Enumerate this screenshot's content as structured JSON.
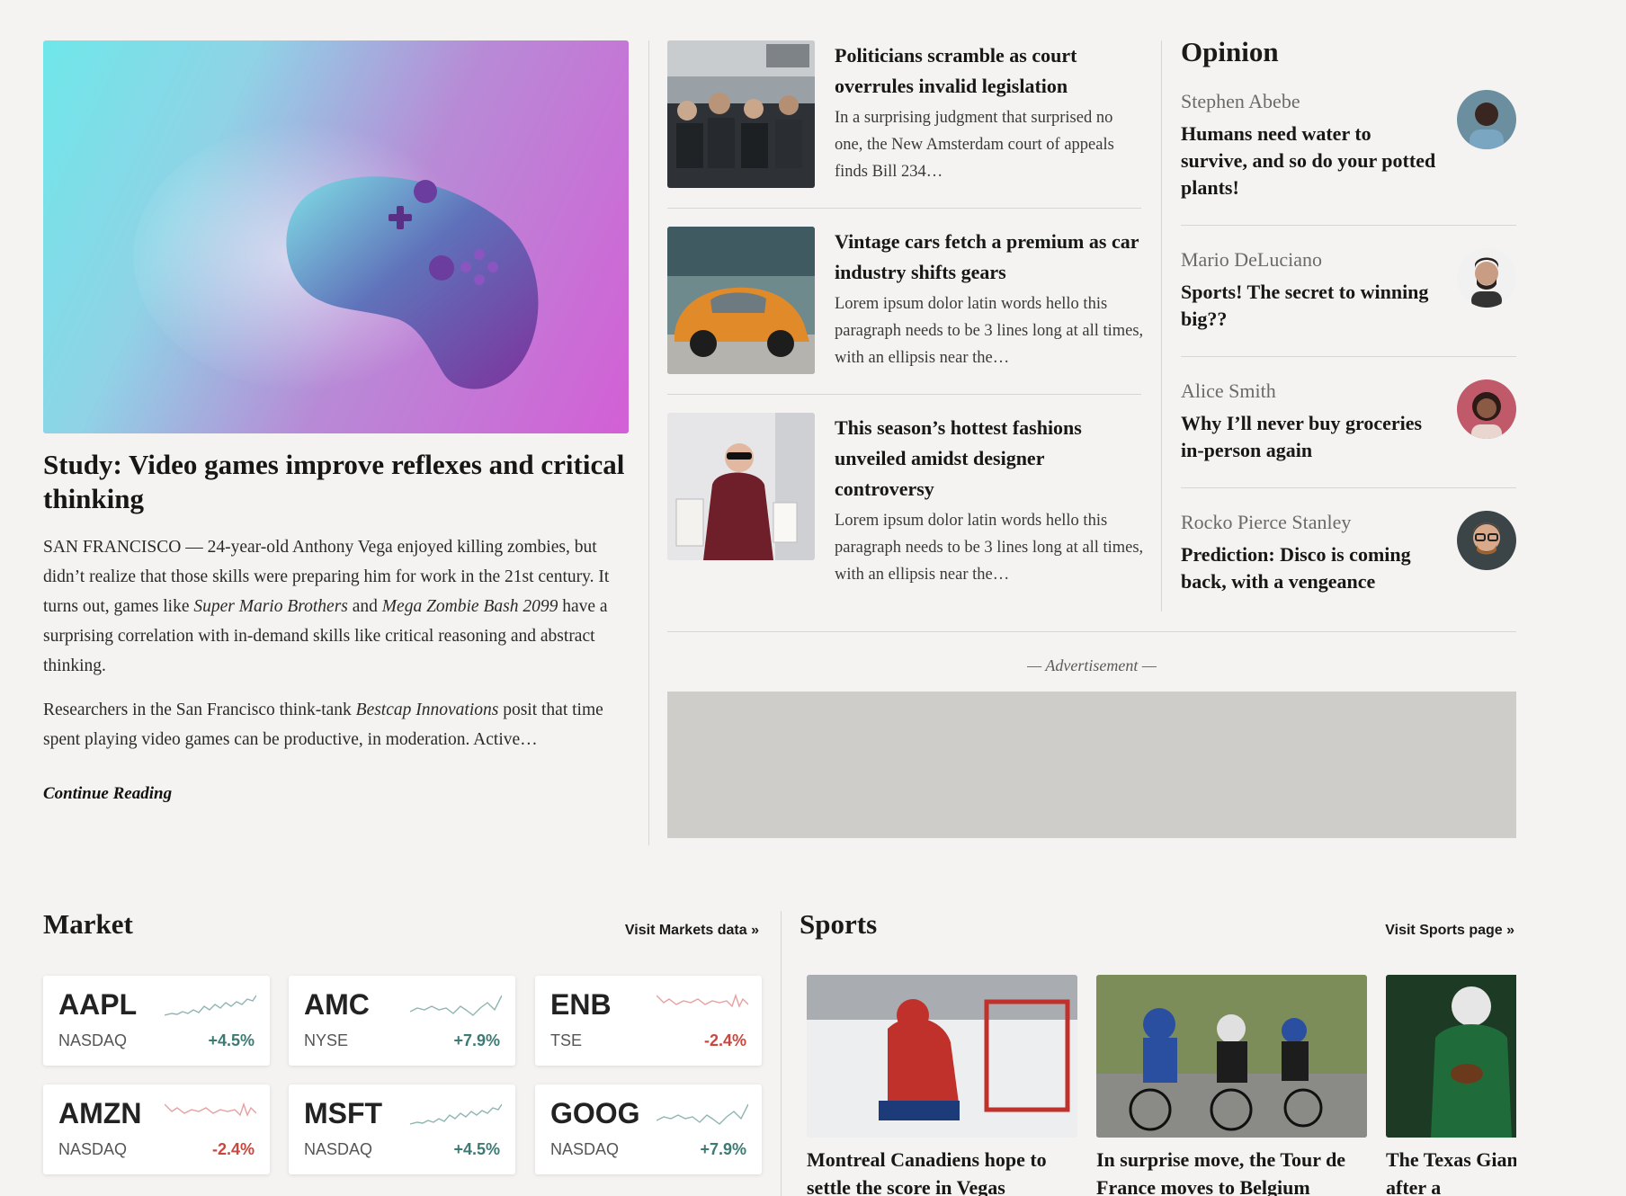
{
  "featured": {
    "title": "Study: Video games improve reflexes and critical thinking",
    "p1_a": "SAN FRANCISCO — 24-year-old Anthony Vega enjoyed killing zombies, but didn’t realize that those skills were preparing him for work in the 21st century. It turns out, games like ",
    "p1_em1": "Super Mario Brothers",
    "p1_b": " and ",
    "p1_em2": "Mega Zombie Bash 2099",
    "p1_c": " have a surprising correlation with in-demand skills like critical reasoning and abstract thinking.",
    "p2_a": "Researchers in the San Francisco think-tank ",
    "p2_em": "Bestcap Innovations",
    "p2_b": " posit that time spent playing video games can be productive, in moderation. Active…",
    "continue": "Continue Reading"
  },
  "stories": [
    {
      "title": "Politicians scramble as court overrules invalid legislation",
      "summary": "In a surprising judgment that surprised no one, the New Amsterdam court of appeals finds Bill 234…"
    },
    {
      "title": "Vintage cars fetch a premium as car industry shifts gears",
      "summary": "Lorem ipsum dolor latin words hello this paragraph needs to be 3 lines long at all times, with an ellipsis near the…"
    },
    {
      "title": "This season’s hottest fashions unveiled amidst designer controversy",
      "summary": "Lorem ipsum dolor latin words hello this paragraph needs to be 3 lines long at all times, with an ellipsis near the…"
    }
  ],
  "opinion": {
    "heading": "Opinion",
    "items": [
      {
        "author": "Stephen Abebe",
        "title": "Humans need water to survive, and so do your potted plants!"
      },
      {
        "author": "Mario DeLuciano",
        "title": "Sports! The secret to winning big??"
      },
      {
        "author": "Alice Smith",
        "title": "Why I’ll never buy groceries in-person again"
      },
      {
        "author": "Rocko Pierce Stanley",
        "title": "Prediction: Disco is coming back, with a vengeance"
      }
    ]
  },
  "advertisement": {
    "label": "— Advertisement —"
  },
  "market": {
    "heading": "Market",
    "link": "Visit Markets data »",
    "colors": {
      "up": "#3d7a74",
      "down": "#c9473f"
    },
    "stocks": [
      {
        "ticker": "AAPL",
        "exchange": "NASDAQ",
        "change": "+4.5%",
        "direction": "up"
      },
      {
        "ticker": "AMC",
        "exchange": "NYSE",
        "change": "+7.9%",
        "direction": "up"
      },
      {
        "ticker": "ENB",
        "exchange": "TSE",
        "change": "-2.4%",
        "direction": "down"
      },
      {
        "ticker": "AMZN",
        "exchange": "NASDAQ",
        "change": "-2.4%",
        "direction": "down"
      },
      {
        "ticker": "MSFT",
        "exchange": "NASDAQ",
        "change": "+4.5%",
        "direction": "up"
      },
      {
        "ticker": "GOOG",
        "exchange": "NASDAQ",
        "change": "+7.9%",
        "direction": "up"
      }
    ]
  },
  "sports": {
    "heading": "Sports",
    "link": "Visit Sports page »",
    "items": [
      {
        "title": "Montreal Canadiens hope to settle the score in Vegas"
      },
      {
        "title": "In surprise move, the Tour de France moves to Belgium"
      },
      {
        "title": "The Texas Giants claim victory after a"
      }
    ]
  }
}
